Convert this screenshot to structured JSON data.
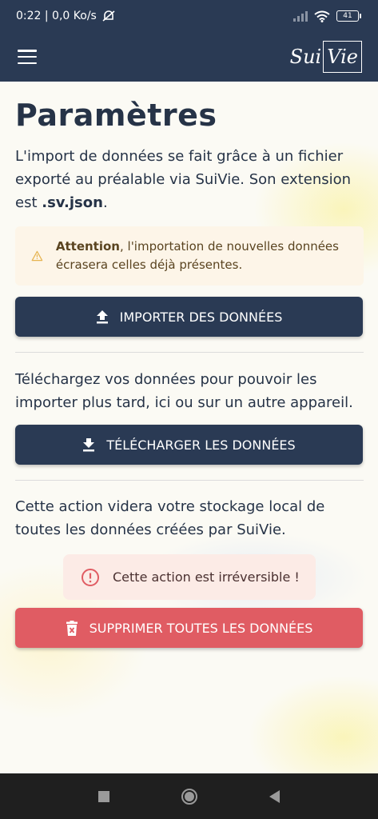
{
  "status_bar": {
    "time_speed": "0:22 | 0,0 Ko/s",
    "battery": "41"
  },
  "app_bar": {
    "logo_part1": "Sui",
    "logo_part2": "Vie"
  },
  "page": {
    "title": "Paramètres",
    "import_intro_1": "L'import de données se fait grâce à un fichier exporté au préalable via SuiVie. Son extension est ",
    "import_intro_ext": ".sv.json",
    "import_intro_2": ".",
    "warning_strong": "Attention",
    "warning_text": ", l'importation de nouvelles données écrasera celles déjà présentes.",
    "import_button": "IMPORTER DES DONNÉES",
    "download_text": "Téléchargez vos données pour pouvoir les importer plus tard, ici ou sur un autre appareil.",
    "download_button": "TÉLÉCHARGER LES DONNÉES",
    "delete_text": "Cette action videra votre stockage local de toutes les données créées par SuiVie.",
    "irreversible_text": "Cette action est irréversible !",
    "delete_button": "SUPPRIMER TOUTES LES DONNÉES"
  },
  "icons": {
    "menu": "hamburger-menu-icon",
    "warning": "warning-triangle-icon",
    "upload": "upload-icon",
    "download": "download-icon",
    "alert": "alert-circle-icon",
    "delete": "trash-icon"
  },
  "colors": {
    "primary": "#2a3a54",
    "danger": "#e05c63",
    "warning_bg": "#fdf5e8",
    "danger_bg": "#fcebe6"
  }
}
